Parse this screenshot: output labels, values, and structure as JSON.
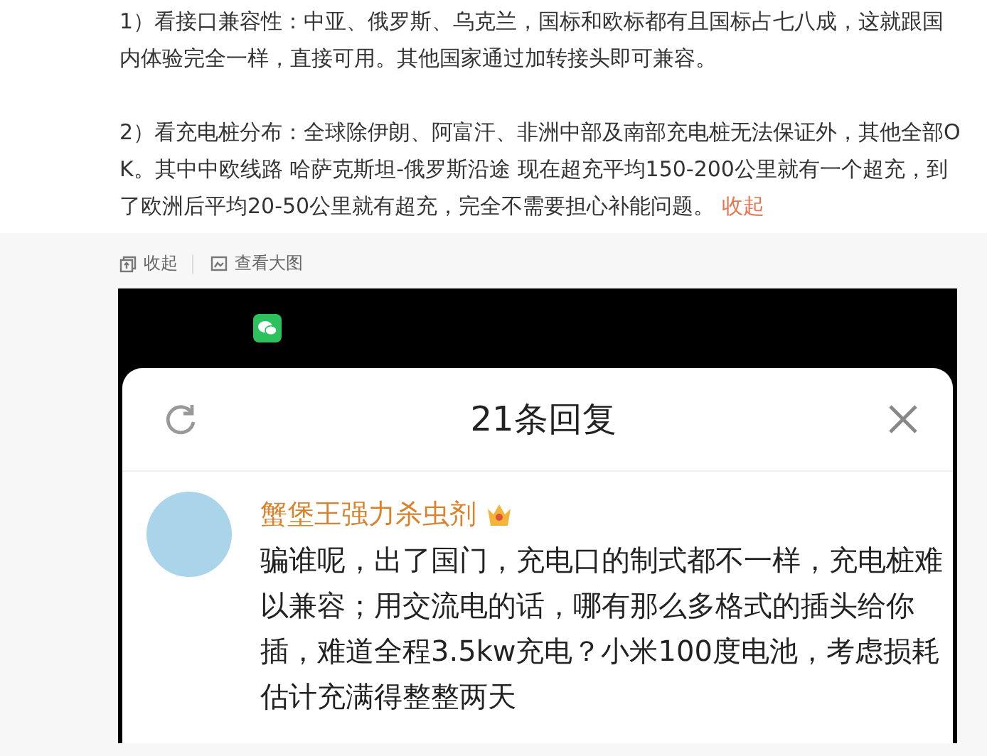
{
  "article": {
    "paragraphs": [
      {
        "text": "1）看接口兼容性：中亚、俄罗斯、乌克兰，国标和欧标都有且国标占七八成，这就跟国内体验完全一样，直接可用。其他国家通过加转接头即可兼容。"
      },
      {
        "text": "2）看充电桩分布：全球除伊朗、阿富汗、非洲中部及南部充电桩无法保证外，其他全部OK。其中中欧线路  哈萨克斯坦-俄罗斯沿途 现在超充平均150-200公里就有一个超充，到了欧洲后平均20-50公里就有超充，完全不需要担心补能问题。",
        "link": "收起"
      }
    ]
  },
  "toolbar": [
    {
      "kind": "collapse",
      "label": "收起"
    },
    {
      "kind": "image",
      "label": "查看大图"
    }
  ],
  "screenshot": {
    "sheet_title": "21条回复",
    "comment": {
      "author": "蟹堡王强力杀虫剂",
      "text": "骗谁呢，出了国门，充电口的制式都不一样，充电桩难以兼容；用交流电的话，哪有那么多格式的插头给你插，难道全程3.5kw充电？小米100度电池，考虑损耗估计充满得整整两天"
    }
  }
}
